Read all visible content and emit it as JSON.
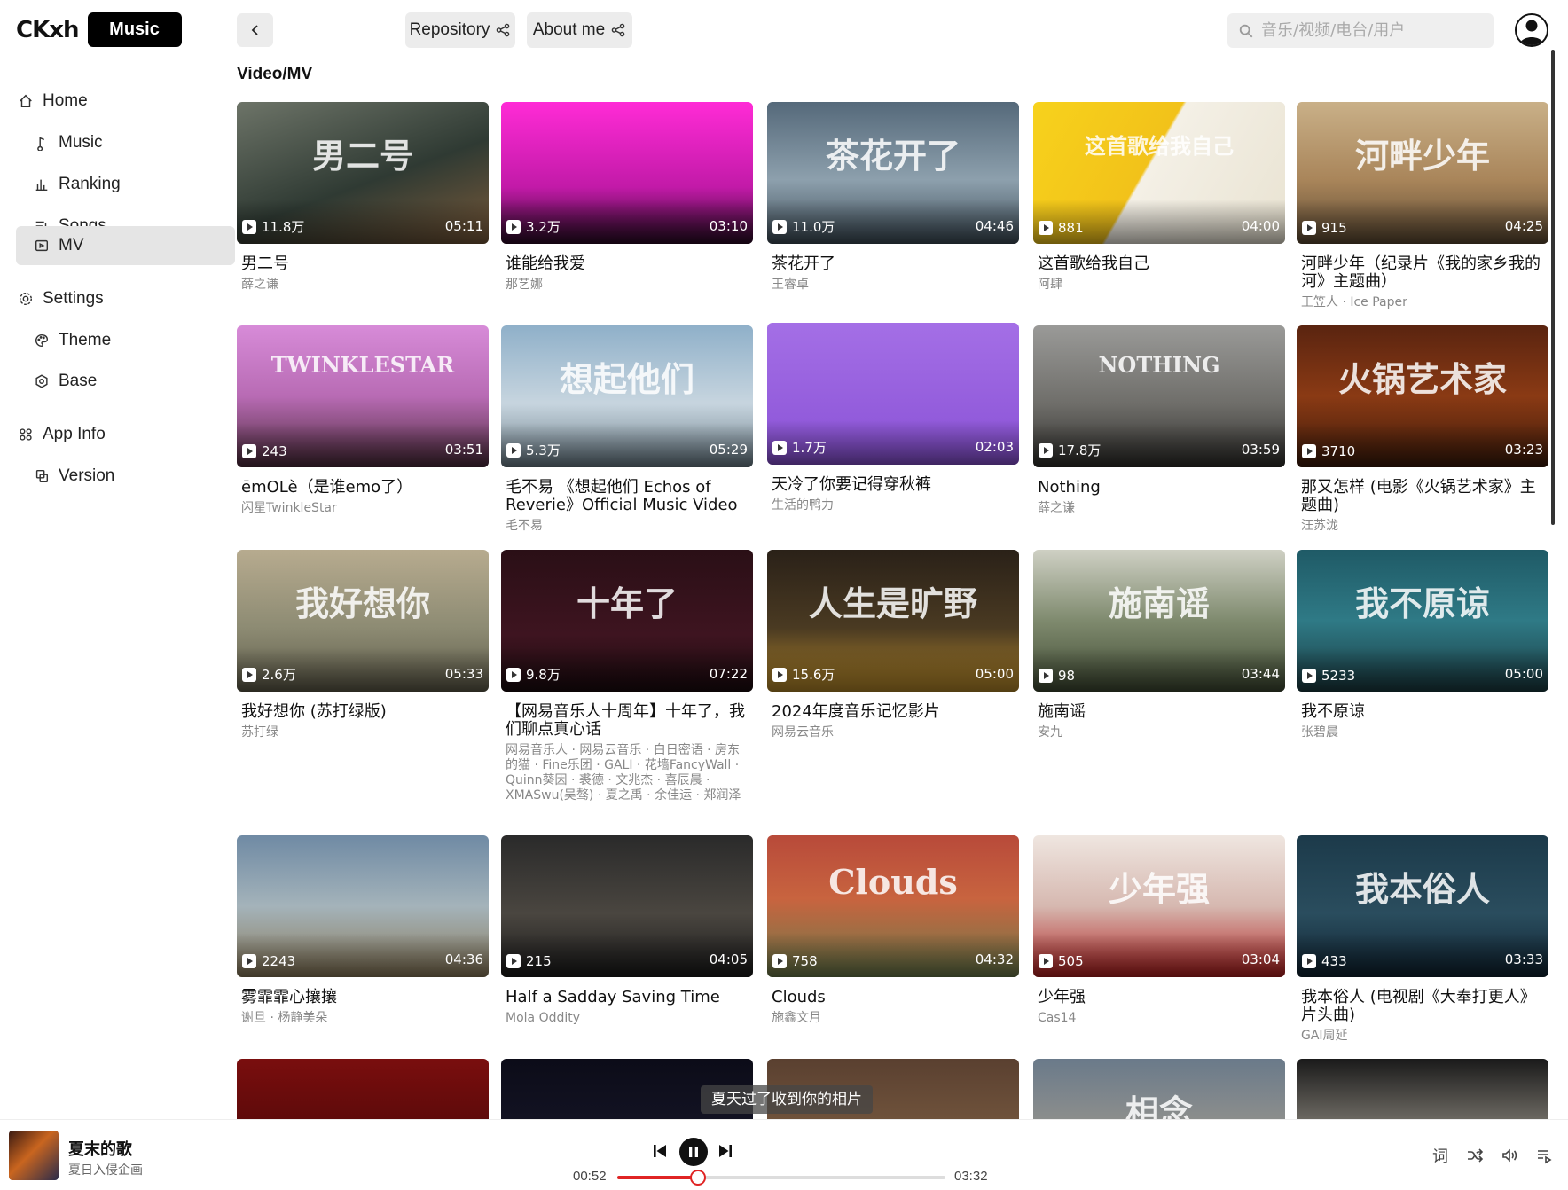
{
  "brand": {
    "logo_text": "CKxh",
    "badge": "Music"
  },
  "nav": {
    "home": "Home",
    "music": "Music",
    "ranking": "Ranking",
    "songs": "Songs",
    "mv": "MV",
    "settings": "Settings",
    "theme": "Theme",
    "base": "Base",
    "app_info": "App Info",
    "version": "Version"
  },
  "header": {
    "repository": "Repository",
    "about": "About me",
    "search_placeholder": "音乐/视频/电台/用户"
  },
  "page_title": "Video/MV",
  "videos": [
    {
      "title": "男二号",
      "artist": "薛之谦",
      "plays": "11.8万",
      "duration": "05:11",
      "bg": "linear-gradient(160deg,#6d7468,#2f3a33 55%,#7a5a3a)",
      "art": "男二号"
    },
    {
      "title": "谁能给我爱",
      "artist": "那艺娜",
      "plays": "3.2万",
      "duration": "03:10",
      "bg": "linear-gradient(180deg,#ff2bd6,#c21aa8 60%,#2a0a25)",
      "art": ""
    },
    {
      "title": "茶花开了",
      "artist": "王睿卓",
      "plays": "11.0万",
      "duration": "04:46",
      "bg": "linear-gradient(180deg,#55697a,#8da0ad 55%,#3d4c57)",
      "art": "茶花开了"
    },
    {
      "title": "这首歌给我自己",
      "artist": "阿肆",
      "plays": "881",
      "duration": "04:00",
      "bg": "linear-gradient(120deg,#f7d21c,#f2c21a 45%,#f4f0e6 46%,#e9e3d2)",
      "art": "这首歌给我自己"
    },
    {
      "title": "河畔少年（纪录片《我的家乡我的河》主题曲）",
      "artist": "王笠人 · Ice Paper",
      "plays": "915",
      "duration": "04:25",
      "bg": "linear-gradient(180deg,#c9b088,#a9855a 55%,#5d4a33)",
      "art": "河畔少年"
    },
    {
      "title": "ēmOLè（是谁emo了）",
      "artist": "闪星TwinkleStar",
      "plays": "243",
      "duration": "03:51",
      "bg": "linear-gradient(180deg,#d78bd8,#b86bb4 50%,#4b2a3a)",
      "art": "TWINKLESTAR"
    },
    {
      "title": "毛不易 《想起他们 Echos of Reverie》Official Music Video",
      "artist": "毛不易",
      "plays": "5.3万",
      "duration": "05:29",
      "bg": "linear-gradient(180deg,#8fb0c9,#c7d5df 55%,#6b7d88)",
      "art": "想起他们"
    },
    {
      "title": "天冷了你要记得穿秋裤",
      "artist": "生活的鸭力",
      "plays": "1.7万",
      "duration": "02:03",
      "bg": "linear-gradient(180deg,#a46fe6,#8a52d6)",
      "art": ""
    },
    {
      "title": "Nothing",
      "artist": "薛之谦",
      "plays": "17.8万",
      "duration": "03:59",
      "bg": "linear-gradient(180deg,#9a9a98,#6f6e6a 55%,#2e2d2a)",
      "art": "NOTHING"
    },
    {
      "title": "那又怎样 (电影《火锅艺术家》主题曲)",
      "artist": "汪苏泷",
      "plays": "3710",
      "duration": "03:23",
      "bg": "linear-gradient(180deg,#5a2410,#8a3a14 50%,#3b1a0a)",
      "art": "火锅艺术家"
    },
    {
      "title": "我好想你 (苏打绿版)",
      "artist": "苏打绿",
      "plays": "2.6万",
      "duration": "05:33",
      "bg": "linear-gradient(180deg,#b7ab8f,#8d8b73 55%,#5f5c4a)",
      "art": "我好想你"
    },
    {
      "title": "【网易音乐人十周年】十年了，我们聊点真心话",
      "artist": "网易音乐人 · 网易云音乐 · 白日密语 · 房东的猫 · Fine乐团 · GALI · 花墙FancyWall · Quinn葵因 · 裘德 · 文兆杰 · 喜辰晨 · XMASwu(吴骜) · 夏之禹 · 余佳运 · 郑润泽",
      "plays": "9.8万",
      "duration": "07:22",
      "bg": "linear-gradient(180deg,#2a0f16,#3e1420 60%,#1a0a0e)",
      "art": "十年了"
    },
    {
      "title": "2024年度音乐记忆影片",
      "artist": "网易云音乐",
      "plays": "15.6万",
      "duration": "05:00",
      "bg": "linear-gradient(180deg,#2a2118,#4a3a22 55%,#b88a2a)",
      "art": "人生是旷野"
    },
    {
      "title": "施南谣",
      "artist": "安九",
      "plays": "98",
      "duration": "03:44",
      "bg": "linear-gradient(180deg,#cfd0c4,#7f8a6e 50%,#3f4a33)",
      "art": "施南谣"
    },
    {
      "title": "我不原谅",
      "artist": "张碧晨",
      "plays": "5233",
      "duration": "05:00",
      "bg": "linear-gradient(180deg,#1f5a66,#2f7a86 50%,#1a3a40)",
      "art": "我不原谅"
    },
    {
      "title": "雾霏霏心攘攘",
      "artist": "谢旦 · 杨静美朵",
      "plays": "2243",
      "duration": "04:36",
      "bg": "linear-gradient(180deg,#6f8aa4,#a4b3ba 50%,#8a7a5a)",
      "art": ""
    },
    {
      "title": "Half a Saddаy Saving Time",
      "artist": "Mola Oddity",
      "plays": "215",
      "duration": "04:05",
      "bg": "linear-gradient(180deg,#2a2a2a,#4a4640 55%,#1a1a1a)",
      "art": ""
    },
    {
      "title": "Clouds",
      "artist": "施鑫文月",
      "plays": "758",
      "duration": "04:32",
      "bg": "linear-gradient(180deg,#b84a3a,#c8643f 45%,#6a7a4a)",
      "art": "Clouds"
    },
    {
      "title": "少年强",
      "artist": "Cas14",
      "plays": "505",
      "duration": "03:04",
      "bg": "linear-gradient(180deg,#efe6e0,#d6b8b0 50%,#b21e1e)",
      "art": "少年强"
    },
    {
      "title": "我本俗人 (电视剧《大奉打更人》片头曲)",
      "artist": "GAI周延",
      "plays": "433",
      "duration": "03:33",
      "bg": "linear-gradient(180deg,#1c3a4a,#2a4d5e 55%,#0f2230)",
      "art": "我本俗人"
    },
    {
      "title": "",
      "artist": "",
      "plays": "",
      "duration": "",
      "bg": "linear-gradient(180deg,#7a0e0e,#3a0505)",
      "art": ""
    },
    {
      "title": "",
      "artist": "",
      "plays": "",
      "duration": "",
      "bg": "linear-gradient(180deg,#0c0c18,#1a1a30)",
      "art": ""
    },
    {
      "title": "",
      "artist": "",
      "plays": "",
      "duration": "",
      "bg": "linear-gradient(180deg,#5a4030,#8a6a4a)",
      "art": ""
    },
    {
      "title": "",
      "artist": "",
      "plays": "",
      "duration": "",
      "bg": "linear-gradient(180deg,#6a7a8a,#b8a890)",
      "art": "相念"
    },
    {
      "title": "",
      "artist": "",
      "plays": "",
      "duration": "",
      "bg": "linear-gradient(180deg,#1a1a1a,#d8d0c0)",
      "art": ""
    }
  ],
  "lyric": "夏天过了收到你的相片",
  "player": {
    "title": "夏末的歌",
    "artist": "夏日入侵企画",
    "current_time": "00:52",
    "total_time": "03:32",
    "progress": 0.245,
    "lyrics_button": "词"
  },
  "colors": {
    "accent": "#e02424",
    "active_nav": "#e5e5e5"
  }
}
